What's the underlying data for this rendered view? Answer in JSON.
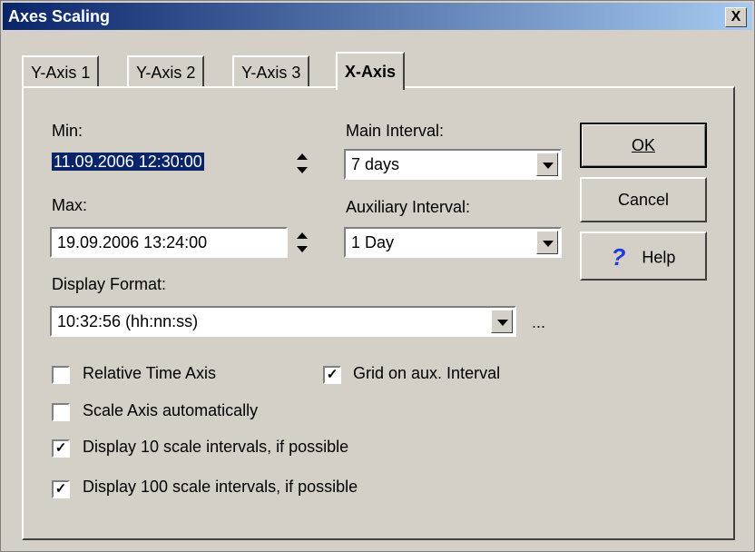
{
  "window": {
    "title": "Axes Scaling",
    "close_label": "X"
  },
  "tabs": [
    {
      "label": "Y-Axis 1",
      "active": false
    },
    {
      "label": "Y-Axis 2",
      "active": false
    },
    {
      "label": "Y-Axis 3",
      "active": false
    },
    {
      "label": "X-Axis",
      "active": true
    }
  ],
  "form": {
    "min_label": "Min:",
    "min_value": "11.09.2006 12:30:00",
    "max_label": "Max:",
    "max_value": "19.09.2006 13:24:00",
    "main_interval_label": "Main Interval:",
    "main_interval_value": "7 days",
    "aux_interval_label": "Auxiliary Interval:",
    "aux_interval_value": "1 Day",
    "display_format_label": "Display Format:",
    "display_format_value": "10:32:56 (hh:nn:ss)",
    "ellipsis": "..."
  },
  "checkboxes": {
    "relative_time": {
      "label": "Relative Time Axis",
      "checked": false
    },
    "grid_aux": {
      "label": "Grid on aux. Interval",
      "checked": true
    },
    "scale_auto": {
      "label": "Scale Axis automatically",
      "checked": false
    },
    "display_10": {
      "label": "Display 10 scale intervals, if possible",
      "checked": true
    },
    "display_100": {
      "label": "Display 100 scale intervals, if possible",
      "checked": true
    }
  },
  "buttons": {
    "ok": "OK",
    "cancel": "Cancel",
    "help": "Help"
  },
  "colors": {
    "title_bar": "#0a246a",
    "dialog_bg": "#d4d0c8",
    "help_icon": "#1e3cd8"
  }
}
